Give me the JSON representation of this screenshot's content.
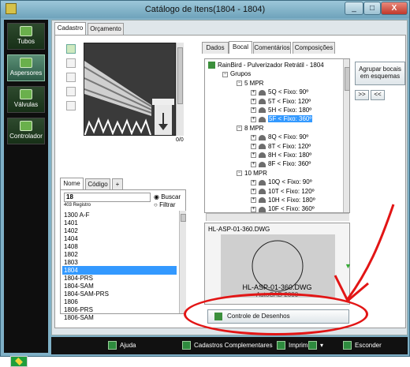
{
  "window": {
    "title": "Catálogo de Itens(1804 - 1804)",
    "min": "_",
    "max": "□",
    "close": "X"
  },
  "nav": {
    "items": [
      {
        "label": "Tubos"
      },
      {
        "label": "Aspersores"
      },
      {
        "label": "Válvulas"
      },
      {
        "label": "Controlador"
      }
    ],
    "active": "Aspersores"
  },
  "tabs_main": [
    "Cadastro",
    "Orçamento"
  ],
  "tabs_detail": [
    "Dados",
    "Bocal",
    "Comentários",
    "Composições"
  ],
  "tabs_list": [
    "Nome",
    "Código",
    "+"
  ],
  "preview_counter": "0/0",
  "search": {
    "value": "18",
    "count": "403 Registro",
    "radio_search": "Buscar",
    "radio_filter": "Filtrar"
  },
  "list": [
    "1300 A-F",
    "1401",
    "1402",
    "1404",
    "1408",
    "1802",
    "1803",
    "1804",
    "1804-PRS",
    "1804-SAM",
    "1804-SAM-PRS",
    "1806",
    "1806-PRS",
    "1806-SAM"
  ],
  "list_selected": "1804",
  "tree": [
    {
      "indent": 0,
      "text": "RainBird - Pulverizador Retrátil - 1804",
      "kind": "root"
    },
    {
      "indent": 1,
      "text": "Grupos",
      "kind": "minus"
    },
    {
      "indent": 2,
      "text": "5 MPR",
      "kind": "minus"
    },
    {
      "indent": 3,
      "text": "5Q < Fixo: 90º",
      "kind": "noz"
    },
    {
      "indent": 3,
      "text": "5T < Fixo: 120º",
      "kind": "noz"
    },
    {
      "indent": 3,
      "text": "5H < Fixo: 180º",
      "kind": "noz"
    },
    {
      "indent": 3,
      "text": "5F < Fixo: 360º",
      "kind": "noz",
      "sel": true
    },
    {
      "indent": 2,
      "text": "8 MPR",
      "kind": "minus"
    },
    {
      "indent": 3,
      "text": "8Q < Fixo: 90º",
      "kind": "noz"
    },
    {
      "indent": 3,
      "text": "8T < Fixo: 120º",
      "kind": "noz"
    },
    {
      "indent": 3,
      "text": "8H < Fixo: 180º",
      "kind": "noz"
    },
    {
      "indent": 3,
      "text": "8F < Fixo: 360º",
      "kind": "noz"
    },
    {
      "indent": 2,
      "text": "10 MPR",
      "kind": "minus"
    },
    {
      "indent": 3,
      "text": "10Q < Fixo: 90º",
      "kind": "noz"
    },
    {
      "indent": 3,
      "text": "10T < Fixo: 120º",
      "kind": "noz"
    },
    {
      "indent": 3,
      "text": "10H < Fixo: 180º",
      "kind": "noz"
    },
    {
      "indent": 3,
      "text": "10F < Fixo: 360º",
      "kind": "noz"
    }
  ],
  "group_button": "Agrupar bocais em esquemas",
  "nav_next": ">>",
  "nav_prev": "<<",
  "drawing": {
    "file": "HL-ASP-01-360.DWG",
    "caption": "HL-ASP-01-360.DWG",
    "sub": "AutoCAD 2000"
  },
  "controle_button": "Controle de Desenhos",
  "statusbar": {
    "help": "Ajuda",
    "cadastros": "Cadastros Complementares",
    "print": "Imprimir",
    "exit": "Esconder"
  },
  "colors": {
    "accent": "#3399ff",
    "annotation": "#e21515"
  }
}
